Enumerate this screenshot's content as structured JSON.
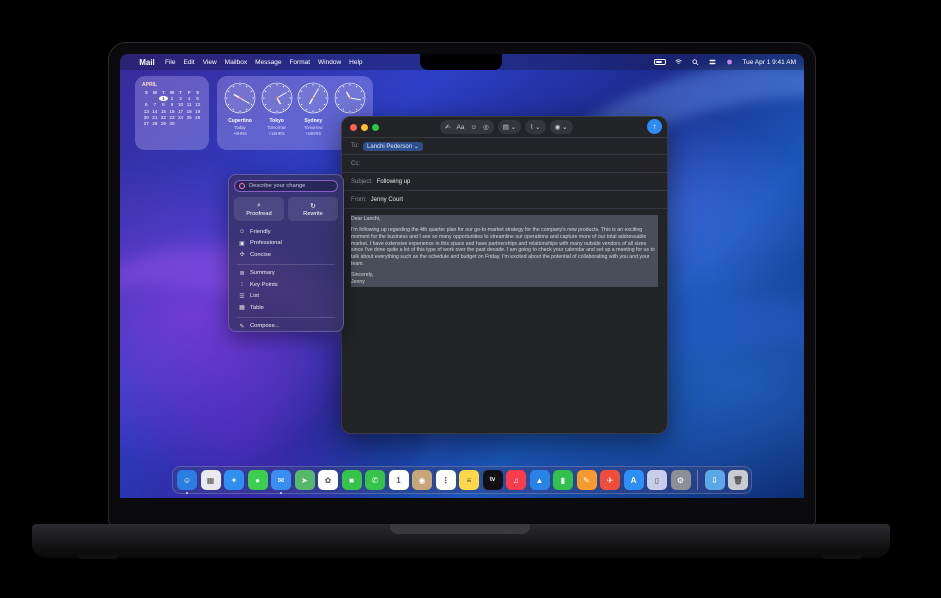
{
  "menubar": {
    "app_name": "Mail",
    "items": [
      "File",
      "Edit",
      "View",
      "Mailbox",
      "Message",
      "Format",
      "Window",
      "Help"
    ],
    "datetime": "Tue Apr 1  9:41 AM"
  },
  "calendar": {
    "month": "APRIL",
    "weekdays": [
      "S",
      "M",
      "T",
      "W",
      "T",
      "F",
      "S"
    ],
    "today": 1,
    "rows": [
      [
        "",
        "",
        "1",
        "2",
        "3",
        "4",
        "5"
      ],
      [
        "6",
        "7",
        "8",
        "9",
        "10",
        "11",
        "12"
      ],
      [
        "13",
        "14",
        "15",
        "16",
        "17",
        "18",
        "19"
      ],
      [
        "20",
        "21",
        "22",
        "23",
        "24",
        "25",
        "26"
      ],
      [
        "27",
        "28",
        "29",
        "30",
        "",
        "",
        ""
      ]
    ]
  },
  "clocks": [
    {
      "city": "Cupertino",
      "day": "Today",
      "offset": "+0HRS"
    },
    {
      "city": "Tokyo",
      "day": "Tomorrow",
      "offset": "+16HRS"
    },
    {
      "city": "Sydney",
      "day": "Tomorrow",
      "offset": "+18HRS"
    },
    {
      "city": "",
      "day": "",
      "offset": ""
    }
  ],
  "mail": {
    "to_label": "To:",
    "to_recipient": "Lanchi Pederson",
    "cc_label": "Cc:",
    "subject_label": "Subject:",
    "subject": "Following up",
    "from_label": "From:",
    "from": "Jenny Court",
    "greeting": "Dear Lanchi,",
    "paragraph": "I'm following up regarding the 4th quarter plan for our go-to-market strategy for the company's new products. This is an exciting moment for the business and I see so many opportunities to streamline our operations and capture more of our total addressable market. I have extensive experience in this space and have partnerships and relationships with many outside vendors of all sizes since I've done quite a lot of this type of work over the past decade. I am going to check your calendar and set up a meeting for us to talk about everything such as the schedule and budget on Friday. I'm excited about the potential of collaborating with you and your team.",
    "closing": "Sincerely,",
    "signature": "Jenny"
  },
  "tools": {
    "describe_placeholder": "Describe your change",
    "proofread": "Proofread",
    "rewrite": "Rewrite",
    "tones": [
      "Friendly",
      "Professional",
      "Concise"
    ],
    "formats": [
      "Summary",
      "Key Points",
      "List",
      "Table"
    ],
    "compose": "Compose..."
  },
  "dock": {
    "apps": [
      {
        "name": "finder",
        "color": "#2a7de1",
        "glyph": "☺",
        "running": true
      },
      {
        "name": "launchpad",
        "color": "#e9e9ee",
        "glyph": "▦",
        "running": false
      },
      {
        "name": "safari",
        "color": "#2e8ff0",
        "glyph": "✦",
        "running": false
      },
      {
        "name": "messages",
        "color": "#3ccf4e",
        "glyph": "●",
        "running": false
      },
      {
        "name": "mail",
        "color": "#3a8ef2",
        "glyph": "✉",
        "running": true
      },
      {
        "name": "maps",
        "color": "#55b86a",
        "glyph": "➤",
        "running": false
      },
      {
        "name": "photos",
        "color": "#ffffff",
        "glyph": "✿",
        "running": false
      },
      {
        "name": "facetime",
        "color": "#36c24b",
        "glyph": "■",
        "running": false
      },
      {
        "name": "phone",
        "color": "#36c24b",
        "glyph": "✆",
        "running": false
      },
      {
        "name": "calendar",
        "color": "#ffffff",
        "glyph": "1",
        "running": false
      },
      {
        "name": "contacts",
        "color": "#c9a57a",
        "glyph": "◉",
        "running": false
      },
      {
        "name": "reminders",
        "color": "#ffffff",
        "glyph": "⋮",
        "running": false
      },
      {
        "name": "notes",
        "color": "#ffd84a",
        "glyph": "≡",
        "running": false
      },
      {
        "name": "tv",
        "color": "#111111",
        "glyph": "tv",
        "running": false
      },
      {
        "name": "music",
        "color": "#fa3c4f",
        "glyph": "♫",
        "running": false
      },
      {
        "name": "keynote",
        "color": "#2a84e8",
        "glyph": "▲",
        "running": false
      },
      {
        "name": "numbers",
        "color": "#34c04d",
        "glyph": "▮",
        "running": false
      },
      {
        "name": "pages",
        "color": "#f59a2f",
        "glyph": "✎",
        "running": false
      },
      {
        "name": "rocket",
        "color": "#ef4d3c",
        "glyph": "✈",
        "running": false
      },
      {
        "name": "app-store",
        "color": "#2d8ef5",
        "glyph": "A",
        "running": false
      },
      {
        "name": "iphone-mirroring",
        "color": "#c9cde8",
        "glyph": "▯",
        "running": false
      },
      {
        "name": "settings",
        "color": "#8d8f96",
        "glyph": "⚙",
        "running": false
      }
    ],
    "extras": [
      {
        "name": "downloads",
        "color": "#5aa9e6",
        "glyph": "⇩"
      },
      {
        "name": "trash",
        "color": "#c8cbd2",
        "glyph": "🗑"
      }
    ]
  }
}
